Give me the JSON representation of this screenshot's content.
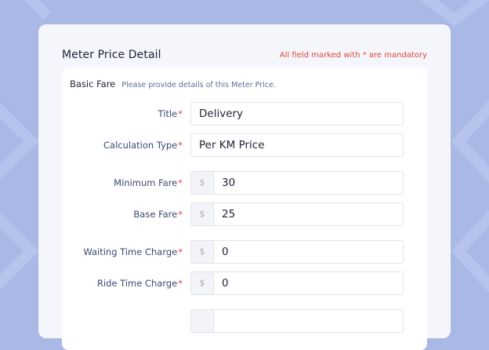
{
  "page": {
    "title": "Meter Price Detail",
    "mandatory_note": "All field marked with * are mandatory"
  },
  "section": {
    "title": "Basic Fare",
    "subtitle": "Please provide details of  this Meter Price."
  },
  "fields": [
    {
      "label": "Title",
      "required": "*",
      "prefix": "",
      "value": "Delivery"
    },
    {
      "label": "Calculation Type",
      "required": "*",
      "prefix": "",
      "value": "Per KM Price"
    },
    {
      "label": "Minimum Fare",
      "required": "*",
      "prefix": "$",
      "value": "30"
    },
    {
      "label": "Base Fare",
      "required": "*",
      "prefix": "$",
      "value": "25"
    },
    {
      "label": "Waiting Time Charge",
      "required": "*",
      "prefix": "$",
      "value": "0"
    },
    {
      "label": "Ride Time Charge",
      "required": "*",
      "prefix": "$",
      "value": "0"
    }
  ],
  "colors": {
    "background": "#aab8e6",
    "required": "#e0453a",
    "label": "#3a4a70"
  }
}
